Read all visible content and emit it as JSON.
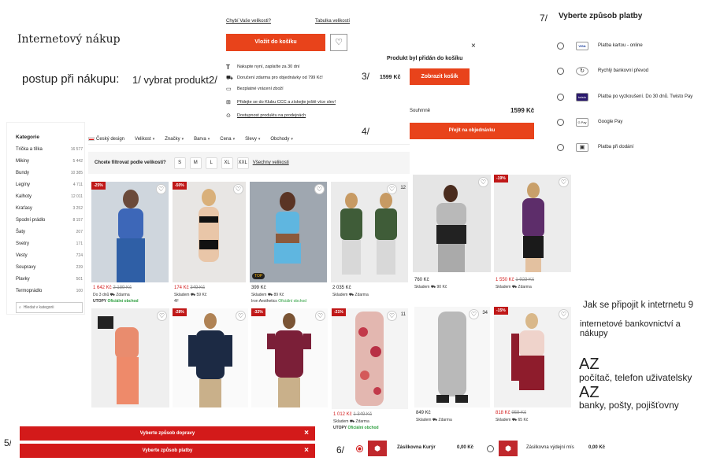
{
  "title": "Internetový nákup",
  "process_label": "postup při nákupu:",
  "steps": {
    "s1": "1/ vybrat produkt",
    "s2": "2/",
    "s3": "3/",
    "s4": "4/",
    "s5": "5/",
    "s6": "6/",
    "s7": "7/"
  },
  "step2": {
    "size_link": "Chybí Vaše velikosti?",
    "table_link": "Tabulka velikostí",
    "add_btn": "Vložit do košíku",
    "info": [
      "Nakupte nyní, zaplaťte za 30 dní",
      "Doručení zdarma pro objednávky od 799 Kč!",
      "Bezplatné vrácení zboží",
      "Přidejte se do Klubu CCC a získejte ještě více slev!",
      "Dostupnost produktu na prodejnách"
    ]
  },
  "step3": {
    "close": "×",
    "added": "Produkt byl přidán do košíku",
    "price": "1599 Kč",
    "show_cart": "Zobrazit košík"
  },
  "step4": {
    "sum_label": "Souhrnně",
    "sum_price": "1599 Kč",
    "go_order": "Přejít na objednávku"
  },
  "step7": {
    "heading": "Vyberte způsob platby",
    "options": [
      {
        "icon": "VISA",
        "label": "Platba kartou - online"
      },
      {
        "icon": "↻",
        "label": "Rychlý bankovní převod"
      },
      {
        "icon": "twisto",
        "label": "Platba po vyzkoušení. Do 30 dnů. Twisto Pay"
      },
      {
        "icon": "G Pay",
        "label": "Google Pay"
      },
      {
        "icon": "▣",
        "label": "Platba při dodání"
      }
    ]
  },
  "sidebar": {
    "heading": "Kategorie",
    "items": [
      {
        "label": "Trička a tílka",
        "count": "16 577"
      },
      {
        "label": "Mikiny",
        "count": "5 442"
      },
      {
        "label": "Bundy",
        "count": "10 385"
      },
      {
        "label": "Legíny",
        "count": "4 711"
      },
      {
        "label": "Kalhoty",
        "count": "12 011"
      },
      {
        "label": "Kraťasy",
        "count": "3 252"
      },
      {
        "label": "Spodní prádlo",
        "count": "8 157"
      },
      {
        "label": "Šaty",
        "count": "207"
      },
      {
        "label": "Svetry",
        "count": "171"
      },
      {
        "label": "Vesty",
        "count": "724"
      },
      {
        "label": "Soupravy",
        "count": "239"
      },
      {
        "label": "Plavky",
        "count": "501"
      },
      {
        "label": "Termoprádlo",
        "count": "100"
      }
    ],
    "search_placeholder": "Hledat v kategorii"
  },
  "filters": {
    "design": "Český design",
    "items": [
      "Velikost",
      "Značky",
      "Barva",
      "Cena",
      "Slevy",
      "Obchody"
    ],
    "size_prompt": "Chcete filtrovat podle velikosti?",
    "sizes": [
      "S",
      "M",
      "L",
      "XL",
      "XXL"
    ],
    "all_sizes": "Všechny velikosti"
  },
  "products_row1": [
    {
      "badge": "-25%",
      "price": "1 642 Kč",
      "old": "2 189 Kč",
      "stock": "Do 3 dnů",
      "delivery": "Zdarma",
      "brand": "UTOPY",
      "official": "Oficiální obchod"
    },
    {
      "badge": "-50%",
      "price": "174 Kč",
      "old": "349 Kč",
      "stock": "Skladem",
      "delivery": "59 Kč",
      "brand": "4F",
      "official": ""
    },
    {
      "badge": "",
      "top": "TOP",
      "price": "399 Kč",
      "old": "",
      "stock": "Skladem",
      "delivery": "89 Kč",
      "brand": "Iron Aesthetics",
      "official": "Oficiální obchod"
    },
    {
      "badge": "",
      "heart_count": "12",
      "price": "2 035 Kč",
      "old": "",
      "stock": "Skladem",
      "delivery": "Zdarma",
      "brand": "",
      "official": ""
    },
    {
      "badge": "",
      "price": "760 Kč",
      "old": "",
      "stock": "Skladem",
      "delivery": "90 Kč",
      "brand": "",
      "official": ""
    },
    {
      "badge": "-19%",
      "price": "1 550 Kč",
      "old": "1 923 Kč",
      "stock": "Skladem",
      "delivery": "Zdarma",
      "brand": "",
      "official": ""
    }
  ],
  "products_row2": [
    {
      "badge": "",
      "price": "",
      "old": ""
    },
    {
      "badge": "-28%",
      "price": "",
      "old": ""
    },
    {
      "badge": "-32%",
      "price": "",
      "old": ""
    },
    {
      "badge": "-21%",
      "heart_count": "11",
      "price": "1 012 Kč",
      "old": "1 349 Kč",
      "stock": "Skladem",
      "delivery": "Zdarma",
      "brand": "UTOPY",
      "official": "Oficiální obchod"
    },
    {
      "badge": "",
      "heart_count": "34",
      "price": "849 Kč",
      "old": "",
      "stock": "Skladem",
      "delivery": "Zdarma",
      "brand": "",
      "official": ""
    },
    {
      "badge": "-15%",
      "price": "818 Kč",
      "old": "959 Kč",
      "stock": "Skladem",
      "delivery": "65 Kč",
      "brand": "",
      "official": ""
    }
  ],
  "right_text": {
    "connect": "Jak se připojit k intetrnetu 9",
    "banking": "internetové bankovnictví a nákupy",
    "az1": "AZ",
    "line1": "počítač, telefon uživatelsky",
    "az2": "AZ",
    "line2": "banky, pošty, pojišťovny"
  },
  "step5": {
    "delivery": "Vyberte způsob dopravy",
    "payment": "Vyberte způsob platby",
    "x": "×"
  },
  "step6": {
    "opt1_label": "Zásilkovna Kurýr",
    "opt1_price": "0,00 Kč",
    "opt2_label": "Zásilkovna výdejní mís",
    "opt2_price": "0,00 Kč"
  },
  "colors": {
    "accent": "#e8431b",
    "red": "#d31a1a"
  }
}
